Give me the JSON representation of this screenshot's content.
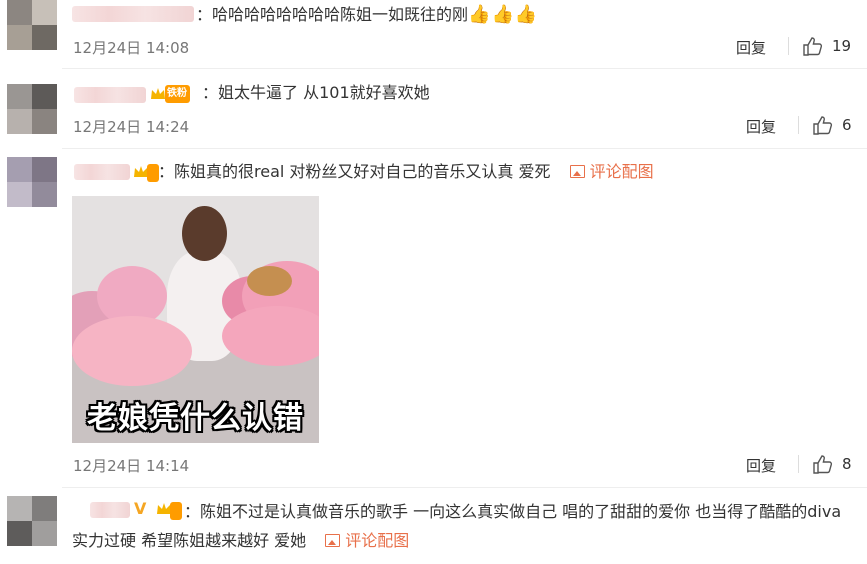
{
  "comments": [
    {
      "text_prefix": "：",
      "text": "哈哈哈哈哈哈哈哈陈姐一如既往的刚",
      "emoji": "👍👍👍",
      "time": "12月24日 14:08",
      "reply": "回复",
      "likes": "19"
    },
    {
      "badge": "铁粉",
      "text": "：姐太牛逼了 从101就好喜欢她",
      "time": "12月24日 14:24",
      "reply": "回复",
      "likes": "6"
    },
    {
      "text": "：陈姐真的很real 对粉丝又好对自己的音乐又认真 爱死",
      "pic_link": "评论配图",
      "image_caption": "老娘凭什么认错",
      "time": "12月24日 14:14",
      "reply": "回复",
      "likes": "8"
    },
    {
      "text": "：陈姐不过是认真做音乐的歌手 一向这么真实做自己  唱的了甜甜的爱你 也当得了酷酷的diva  实力过硬 希望陈姐越来越好 爱她",
      "pic_link": "评论配图"
    }
  ],
  "colors": {
    "accent_link": "#e8704a",
    "badge": "#ff9c00",
    "time": "#777777"
  }
}
